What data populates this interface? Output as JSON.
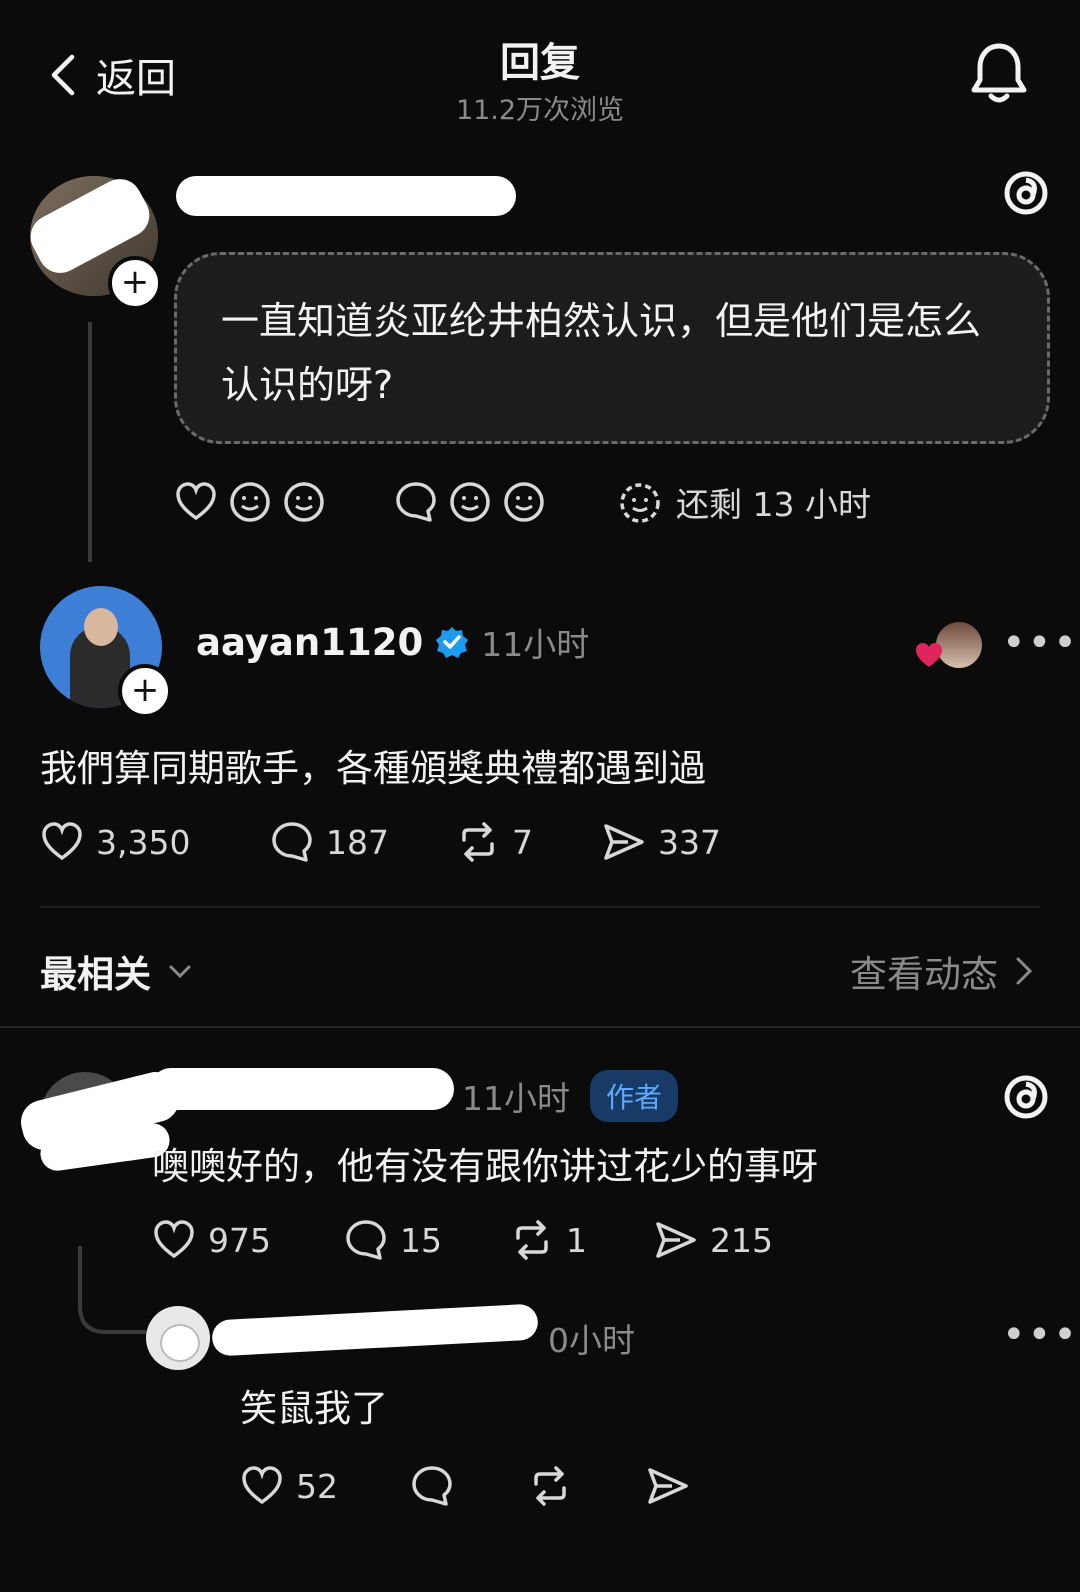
{
  "header": {
    "back_label": "返回",
    "title": "回复",
    "views": "11.2万次浏览"
  },
  "question": {
    "text": "一直知道炎亚纶井柏然认识，但是他们是怎么认识的呀?",
    "remaining": "还剩 13 小时"
  },
  "reply": {
    "handle": "aayan1120",
    "time": "11小时",
    "text": "我們算同期歌手，各種頒獎典禮都遇到過",
    "likes": "3,350",
    "comments": "187",
    "reposts": "7",
    "shares": "337"
  },
  "sort": {
    "label": "最相关",
    "activity_label": "查看动态"
  },
  "comment1": {
    "time": "11小时",
    "badge": "作者",
    "text": "噢噢好的，他有没有跟你讲过花少的事呀",
    "likes": "975",
    "comments": "15",
    "reposts": "1",
    "shares": "215"
  },
  "comment2": {
    "time_visible": "0小时",
    "text": "笑鼠我了",
    "likes": "52"
  },
  "colors": {
    "background": "#0b0b0b",
    "verified": "#1d9bf0",
    "heart_red": "#e0245e",
    "author_badge": "#5fa8ff"
  },
  "icons": [
    "chevron-left-icon",
    "bell-icon",
    "threads-icon",
    "heart-icon",
    "smiley-icon",
    "comment-icon",
    "repost-icon",
    "share-icon",
    "verified-icon",
    "more-icon",
    "chevron-down-icon",
    "chevron-right-icon"
  ]
}
